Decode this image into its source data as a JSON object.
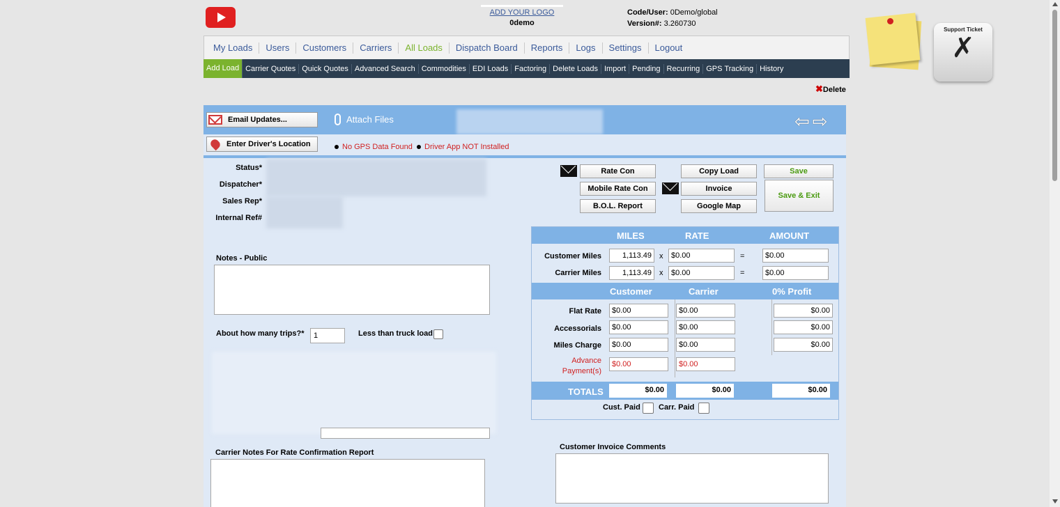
{
  "header": {
    "logo_link": "ADD YOUR LOGO",
    "company": "0demo",
    "code_label": "Code/User:",
    "code_value": "0Demo/global",
    "version_label": "Version#:",
    "version_value": "3.260730",
    "support_label": "Support Ticket"
  },
  "main_nav": [
    "My Loads",
    "Users",
    "Customers",
    "Carriers",
    "All Loads",
    "Dispatch Board",
    "Reports",
    "Logs",
    "Settings",
    "Logout"
  ],
  "main_nav_active": "All Loads",
  "sub_nav": [
    "Add Load",
    "Carrier Quotes",
    "Quick Quotes",
    "Advanced Search",
    "Commodities",
    "EDI Loads",
    "Factoring",
    "Delete Loads",
    "Import",
    "Pending",
    "Recurring",
    "GPS Tracking",
    "History"
  ],
  "sub_nav_active": "Add Load",
  "toolbar": {
    "delete": "Delete",
    "email_updates": "Email Updates...",
    "attach_files": "Attach Files",
    "enter_driver_location": "Enter Driver's Location",
    "gps_status": "No GPS Data Found",
    "driver_app_status": "Driver App NOT Installed"
  },
  "form_labels": {
    "status": "Status*",
    "dispatcher": "Dispatcher*",
    "sales_rep": "Sales Rep*",
    "internal_ref": "Internal Ref#",
    "notes_public": "Notes - Public",
    "trips": "About how many trips?*",
    "trips_value": "1",
    "less_than_truck_load": "Less than truck load",
    "carrier_notes": "Carrier Notes For Rate Confirmation Report",
    "customer_invoice_comments": "Customer Invoice Comments"
  },
  "actions": {
    "rate_con": "Rate Con",
    "mobile_rate_con": "Mobile Rate Con",
    "bol_report": "B.O.L. Report",
    "copy_load": "Copy Load",
    "invoice": "Invoice",
    "google_map": "Google Map",
    "save": "Save",
    "save_exit": "Save & Exit"
  },
  "calc": {
    "headers": {
      "miles": "MILES",
      "rate": "RATE",
      "amount": "AMOUNT"
    },
    "customer_miles": {
      "label": "Customer Miles",
      "miles": "1,113.49",
      "x": "x",
      "rate": "$0.00",
      "eq": "=",
      "amount": "$0.00"
    },
    "carrier_miles": {
      "label": "Carrier Miles",
      "miles": "1,113.49",
      "x": "x",
      "rate": "$0.00",
      "eq": "=",
      "amount": "$0.00"
    },
    "headers2": {
      "customer": "Customer",
      "carrier": "Carrier",
      "profit": "0% Profit"
    },
    "flat_rate": {
      "label": "Flat Rate",
      "customer": "$0.00",
      "carrier": "$0.00",
      "profit": "$0.00"
    },
    "accessorials": {
      "label": "Accessorials",
      "customer": "$0.00",
      "carrier": "$0.00",
      "profit": "$0.00"
    },
    "miles_charge": {
      "label": "Miles Charge",
      "customer": "$0.00",
      "carrier": "$0.00",
      "profit": "$0.00"
    },
    "advance_line1": "Advance",
    "advance_line2": "Payment(s)",
    "advance_customer": "$0.00",
    "advance_carrier": "$0.00",
    "totals": {
      "label": "TOTALS",
      "customer": "$0.00",
      "carrier": "$0.00",
      "profit": "$0.00"
    },
    "cust_paid": "Cust. Paid",
    "carr_paid": "Carr. Paid"
  },
  "colors": {
    "accent_green": "#7bb32e",
    "nav_dark": "#2c3e50",
    "band_blue": "#7fb2e5",
    "alert_red": "#d02020"
  }
}
